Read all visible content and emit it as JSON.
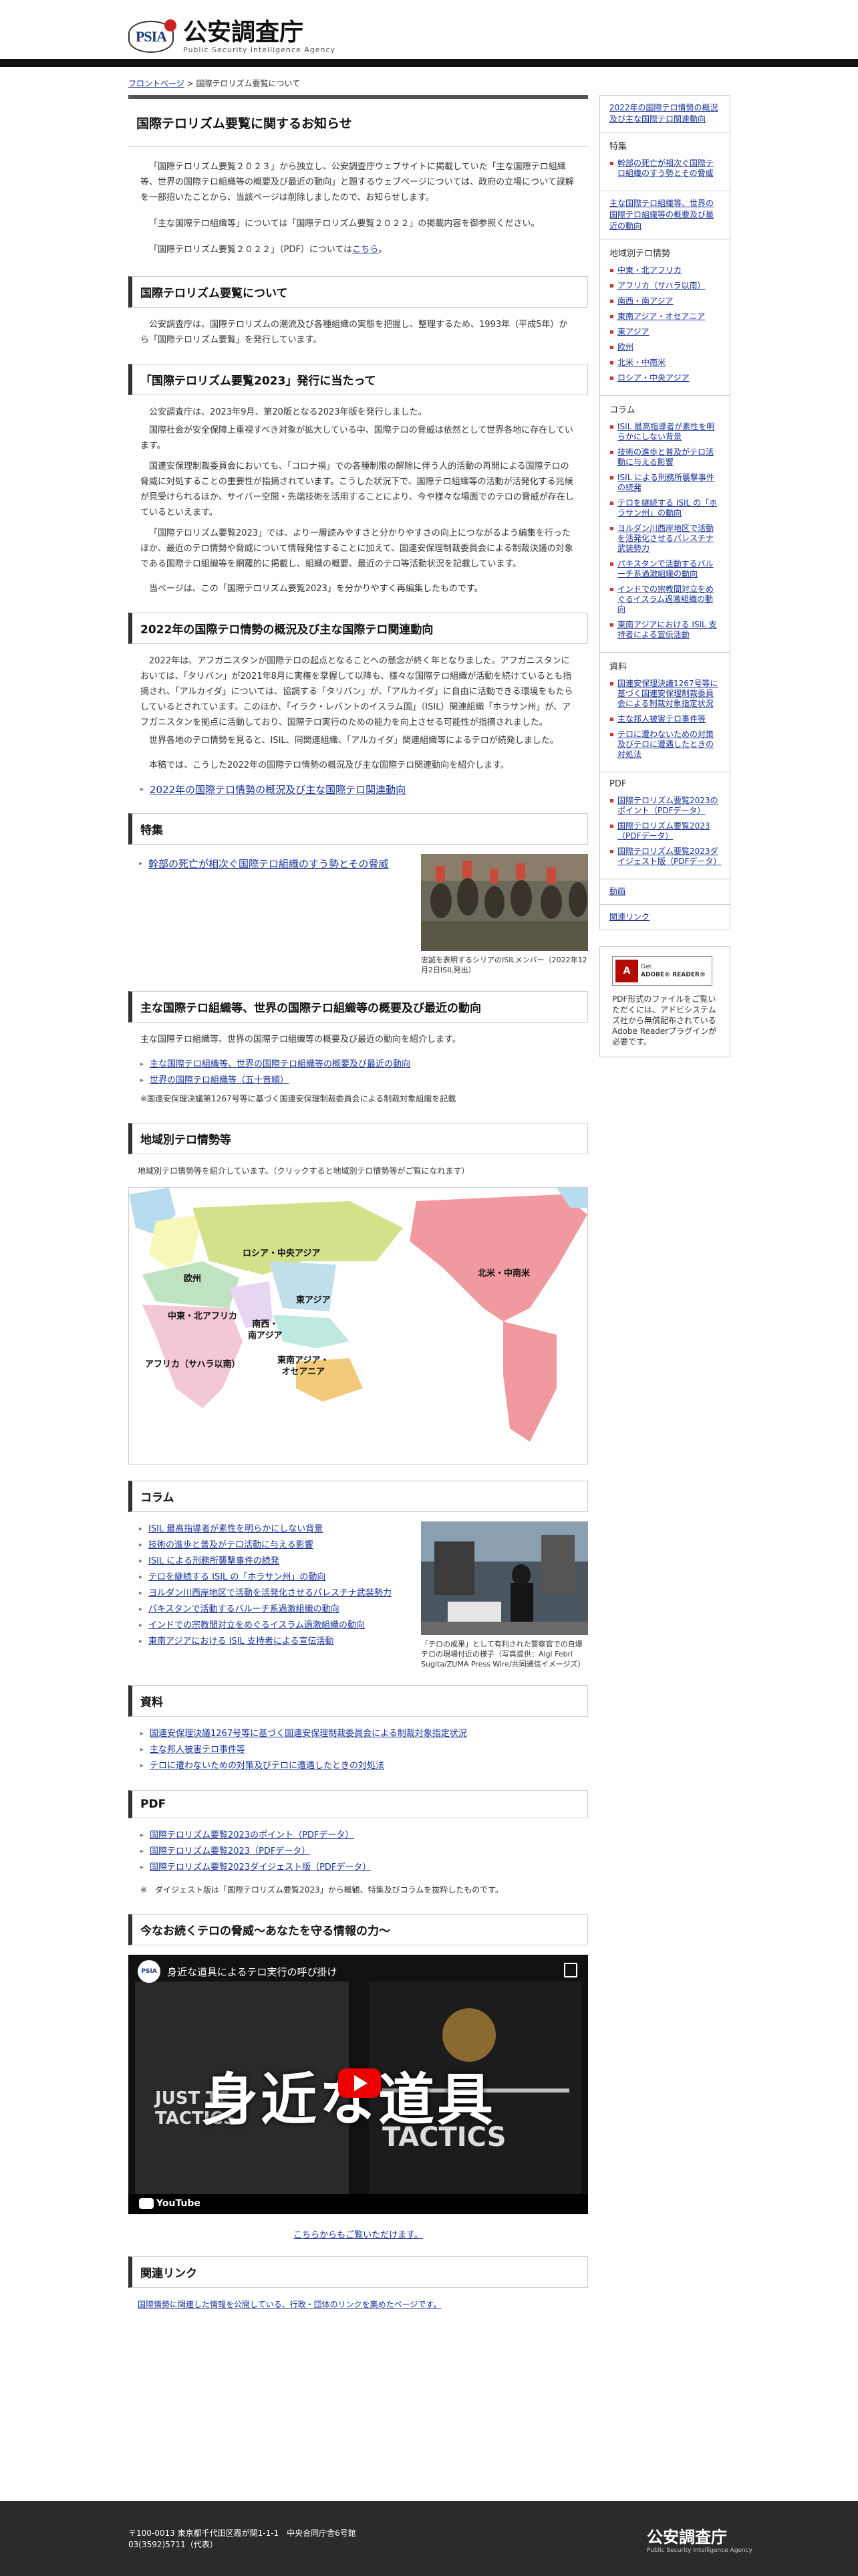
{
  "header": {
    "logo_abbr": "PSIA",
    "site_name": "公安調査庁",
    "site_name_en": "Public Security Intelligence Agency"
  },
  "breadcrumb": {
    "home": "フロントページ",
    "sep": " > ",
    "current": "国際テロリズム要覧について"
  },
  "main": {
    "title": "国際テロリズム要覧に関するお知らせ",
    "intro1": "「国際テロリズム要覧２０２３」から独立し、公安調査庁ウェブサイトに掲載していた「主な国際テロ組織等、世界の国際テロ組織等の概要及び最近の動向」と題するウェブページについては、政府の立場について誤解を一部招いたことから、当該ページは削除しましたので、お知らせします。",
    "intro2": "「主な国際テロ組織等」については「国際テロリズム要覧２０２２」の掲載内容を御参照ください。",
    "intro3_pre": "「国際テロリズム要覧２０２２」（PDF）については",
    "intro3_link": "こちら",
    "intro3_post": "。",
    "s1_title": "国際テロリズム要覧について",
    "s1_p": "公安調査庁は、国際テロリズムの潮流及び各種組織の実態を把握し、整理するため、1993年（平成5年）から「国際テロリズム要覧」を発行しています。",
    "s2_title": "「国際テロリズム要覧2023」発行に当たって",
    "s2_p1": "公安調査庁は、2023年9月、第20版となる2023年版を発行しました。",
    "s2_p2": "国際社会が安全保障上重視すべき対象が拡大している中、国際テロの脅威は依然として世界各地に存在しています。",
    "s2_p3": "国連安保理制裁委員会においても、「コロナ禍」での各種制限の解除に伴う人的活動の再開による国際テロの脅威に対処することの重要性が指摘されています。こうした状況下で、国際テロ組織等の活動が活発化する兆候が見受けられるほか、サイバー空間・先端技術を活用することにより、今や様々な場面でのテロの脅威が存在しているといえます。",
    "s2_p4": "「国際テロリズム要覧2023」では、より一層読みやすさと分かりやすさの向上につながるよう編集を行ったほか、最近のテロ情勢や脅威について情報発信することに加えて、国連安保理制裁委員会による制裁決議の対象である国際テロ組織等を網羅的に掲載し、組織の概要、最近のテロ等活動状況を記載しています。",
    "s2_p5": "当ページは、この「国際テロリズム要覧2023」を分かりやすく再編集したものです。",
    "s3_title": "2022年の国際テロ情勢の概況及び主な国際テロ関連動向",
    "s3_p1": "2022年は、アフガニスタンが国際テロの起点となることへの懸念が終く年となりました。アフガニスタンにおいては、「タリバン」が2021年8月に実権を掌握して以降も、様々な国際テロ組織が活動を続けているとも指摘され、「アルカイダ」については、協調する「タリバン」が、「アルカイダ」に自由に活動できる環境をもたらしているとされています。このほか、「イラク・レバントのイスラム国」（ISIL）関連組織「ホラサン州」が、アフガニスタンを拠点に活動しており、国際テロ実行のための能力を向上させる可能性が指摘されました。",
    "s3_p2": "世界各地のテロ情勢を見ると、ISIL、同関連組織、「アルカイダ」関連組織等によるテロが続発しました。",
    "s3_p3": "本稿では、こうした2022年の国際テロ情勢の概況及び主な国際テロ関連動向を紹介します。",
    "s3_link": "2022年の国際テロ情勢の概況及び主な国際テロ関連動向",
    "s4_title": "特集",
    "s4_link": "幹部の死亡が相次ぐ国際テロ組織のすう勢とその脅威",
    "s4_caption": "忠誠を表明するシリアのISILメンバー（2022年12月2日ISIL発出）",
    "s5_title": "主な国際テロ組織等、世界の国際テロ組織等の概要及び最近の動向",
    "s5_p": "主な国際テロ組織等、世界の国際テロ組織等の概要及び最近の動向を紹介します。",
    "s5_links": [
      "主な国際テロ組織等、世界の国際テロ組織等の概要及び最近の動向",
      "世界の国際テロ組織等（五十音順）"
    ],
    "s5_note": "※国連安保理決議第1267号等に基づく国連安保理制裁委員会による制裁対象組織を記載",
    "s6_title": "地域別テロ情勢等",
    "s6_p": "地域別テロ情勢等を紹介しています。（クリックすると地域別テロ情勢等がご覧になれます）",
    "map": {
      "europe": "欧州",
      "russia": "ロシア・中央アジア",
      "mideast": "中東・北アフリカ",
      "eastasia": "東アジア",
      "swasia": "南西・\n南アジア",
      "africa": "アフリカ（サハラ以南）",
      "seasia": "東南アジア・\nオセアニア",
      "america": "北米・中南米"
    },
    "s7_title": "コラム",
    "s7_links": [
      "ISIL 最高指導者が素性を明らかにしない背景",
      "技術の進歩と普及がテロ活動に与える影響",
      "ISIL による刑務所襲撃事件の続発",
      "テロを継続する ISIL の「ホラサン州」の動向",
      "ヨルダン川西岸地区で活動を活発化させるパレスチナ武装勢力",
      "パキスタンで活動するバルーチ系過激組織の動向",
      "インドでの宗教間対立をめぐるイスラム過激組織の動向",
      "東南アジアにおける ISIL 支持者による宣伝活動"
    ],
    "s7_caption": "「テロの成果」として有利された警察官での自爆テロの現場付近の様子（写真提供：Algi Febri Sugita/ZUMA Press Wire/共同通信イメージズ）",
    "s8_title": "資料",
    "s8_links": [
      "国連安保理決議1267号等に基づく国連安保理制裁委員会による制裁対象指定状況",
      "主な邦人被害テロ事件等",
      "テロに遭わないための対策及びテロに遭遇したときの対処法"
    ],
    "s9_title": "PDF",
    "s9_links": [
      "国際テロリズム要覧2023のポイント（PDFデータ）",
      "国際テロリズム要覧2023（PDFデータ）",
      "国際テロリズム要覧2023ダイジェスト版（PDFデータ）"
    ],
    "s9_note": "※　ダイジェスト版は「国際テロリズム要覧2023」から概観、特集及びコラムを抜粋したものです。",
    "s10_title": "今なお続くテロの脅威〜あなたを守る情報の力〜",
    "video": {
      "title": "身近な道具によるテロ実行の呼び掛け",
      "big": "身近な道具",
      "left_text": "JUST TE\nTACTICS",
      "right_text": "TACTICS",
      "yt": "YouTube"
    },
    "s10_link": "こちらからもご覧いただけます。",
    "s11_title": "関連リンク",
    "s11_link": "国際情勢に関連した情報を公開している、行政・団体のリンクを集めたページです。"
  },
  "side": {
    "top_link": "2022年の国際テロ情勢の概況及び主な国際テロ関連動向",
    "feature_head": "特集",
    "feature_items": [
      "幹部の死亡が相次ぐ国際テロ組織のすう勢とその脅威"
    ],
    "org_link": "主な国際テロ組織等、世界の国際テロ組織等の概要及び最近の動向",
    "region_head": "地域別テロ情勢",
    "regions": [
      "中東・北アフリカ",
      "アフリカ（サハラ以南）",
      "南西・南アジア",
      "東南アジア・オセアニア",
      "東アジア",
      "欧州",
      "北米・中南米",
      "ロシア・中央アジア"
    ],
    "column_head": "コラム",
    "columns": [
      "ISIL 最高指導者が素性を明らかにしない背景",
      "技術の進歩と普及がテロ活動に与える影響",
      "ISIL による刑務所襲撃事件の続発",
      "テロを継続する ISIL の「ホラサン州」の動向",
      "ヨルダン川西岸地区で活動を活発化させるパレスチナ武装勢力",
      "パキスタンで活動するバルーチ系過激組織の動向",
      "インドでの宗教間対立をめぐるイスラム過激組織の動向",
      "東南アジアにおける ISIL 支持者による宣伝活動"
    ],
    "data_head": "資料",
    "data": [
      "国連安保理決議1267号等に基づく国連安保理制裁委員会による制裁対象指定状況",
      "主な邦人被害テロ事件等",
      "テロに遭わないための対策及びテロに遭遇したときの対処法"
    ],
    "pdf_head": "PDF",
    "pdfs": [
      "国際テロリズム要覧2023のポイント（PDFデータ）",
      "国際テロリズム要覧2023（PDFデータ）",
      "国際テロリズム要覧2023ダイジェスト版（PDFデータ）"
    ],
    "video_link": "動画",
    "related_link": "関連リンク",
    "adobe_get": "Get",
    "adobe_name": "ADOBE® READER®",
    "adobe_text": "PDF形式のファイルをご覧いただくには、アドビシステムズ社から無償配布されているAdobe Readerプラグインが必要です。"
  },
  "footer": {
    "addr1": "〒100-0013 東京都千代田区霞が関1-1-1　中央合同庁舎6号館",
    "addr2": "03(3592)5711（代表）",
    "logo": "公安調査庁",
    "logo_en": "Public Security Intelligence Agency"
  }
}
